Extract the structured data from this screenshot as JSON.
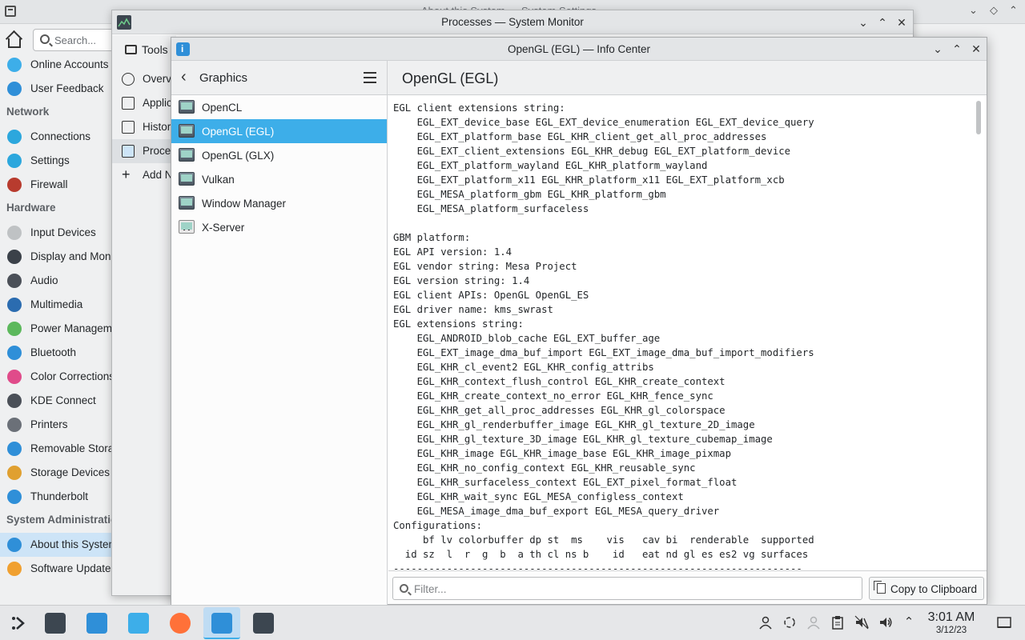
{
  "settings": {
    "window_title": "About this System — System Settings",
    "search_placeholder": "Search...",
    "items_top": [
      {
        "label": "Online Accounts",
        "color": "#3daee9"
      },
      {
        "label": "User Feedback",
        "color": "#2f8fd8"
      }
    ],
    "sections": [
      {
        "title": "Network",
        "items": [
          {
            "label": "Connections",
            "color": "#2ca7dd"
          },
          {
            "label": "Settings",
            "color": "#2ca7dd"
          },
          {
            "label": "Firewall",
            "color": "#b83b2e"
          }
        ]
      },
      {
        "title": "Hardware",
        "items": [
          {
            "label": "Input Devices",
            "color": "#bfc2c4"
          },
          {
            "label": "Display and Monitor",
            "color": "#3b4149"
          },
          {
            "label": "Audio",
            "color": "#4b5058"
          },
          {
            "label": "Multimedia",
            "color": "#2b6cb0"
          },
          {
            "label": "Power Management",
            "color": "#5cb85c"
          },
          {
            "label": "Bluetooth",
            "color": "#2f8fd8"
          },
          {
            "label": "Color Corrections",
            "color": "#e04b8a"
          },
          {
            "label": "KDE Connect",
            "color": "#4b5058"
          },
          {
            "label": "Printers",
            "color": "#6b7078"
          },
          {
            "label": "Removable Storage",
            "color": "#2f8fd8"
          },
          {
            "label": "Storage Devices",
            "color": "#e0a030"
          },
          {
            "label": "Thunderbolt",
            "color": "#2f8fd8"
          }
        ]
      },
      {
        "title": "System Administration",
        "items": [
          {
            "label": "About this System",
            "color": "#2f8fd8",
            "selected": true
          },
          {
            "label": "Software Update",
            "color": "#f0a030"
          }
        ]
      }
    ]
  },
  "sysmon": {
    "title": "Processes — System Monitor",
    "tools_label": "Tools",
    "items": [
      {
        "label": "Overview",
        "icon": "overview-icon"
      },
      {
        "label": "Applications",
        "icon": "applications-icon"
      },
      {
        "label": "History",
        "icon": "history-icon"
      },
      {
        "label": "Processes",
        "icon": "processes-icon",
        "selected": true
      },
      {
        "label": "Add New Page",
        "icon": "add-icon"
      }
    ]
  },
  "info": {
    "title": "OpenGL (EGL) — Info Center",
    "category": "Graphics",
    "page_title": "OpenGL (EGL)",
    "items": [
      {
        "label": "OpenCL"
      },
      {
        "label": "OpenGL (EGL)",
        "selected": true
      },
      {
        "label": "OpenGL (GLX)"
      },
      {
        "label": "Vulkan"
      },
      {
        "label": "Window Manager"
      },
      {
        "label": "X-Server"
      }
    ],
    "content": "EGL client extensions string:\n    EGL_EXT_device_base EGL_EXT_device_enumeration EGL_EXT_device_query\n    EGL_EXT_platform_base EGL_KHR_client_get_all_proc_addresses\n    EGL_EXT_client_extensions EGL_KHR_debug EGL_EXT_platform_device\n    EGL_EXT_platform_wayland EGL_KHR_platform_wayland\n    EGL_EXT_platform_x11 EGL_KHR_platform_x11 EGL_EXT_platform_xcb\n    EGL_MESA_platform_gbm EGL_KHR_platform_gbm\n    EGL_MESA_platform_surfaceless\n\nGBM platform:\nEGL API version: 1.4\nEGL vendor string: Mesa Project\nEGL version string: 1.4\nEGL client APIs: OpenGL OpenGL_ES\nEGL driver name: kms_swrast\nEGL extensions string:\n    EGL_ANDROID_blob_cache EGL_EXT_buffer_age\n    EGL_EXT_image_dma_buf_import EGL_EXT_image_dma_buf_import_modifiers\n    EGL_KHR_cl_event2 EGL_KHR_config_attribs\n    EGL_KHR_context_flush_control EGL_KHR_create_context\n    EGL_KHR_create_context_no_error EGL_KHR_fence_sync\n    EGL_KHR_get_all_proc_addresses EGL_KHR_gl_colorspace\n    EGL_KHR_gl_renderbuffer_image EGL_KHR_gl_texture_2D_image\n    EGL_KHR_gl_texture_3D_image EGL_KHR_gl_texture_cubemap_image\n    EGL_KHR_image EGL_KHR_image_base EGL_KHR_image_pixmap\n    EGL_KHR_no_config_context EGL_KHR_reusable_sync\n    EGL_KHR_surfaceless_context EGL_EXT_pixel_format_float\n    EGL_KHR_wait_sync EGL_MESA_configless_context\n    EGL_MESA_image_dma_buf_export EGL_MESA_query_driver\nConfigurations:\n     bf lv colorbuffer dp st  ms    vis   cav bi  renderable  supported\n  id sz  l  r  g  b  a th cl ns b    id   eat nd gl es es2 vg surfaces\n---------------------------------------------------------------------",
    "filter_placeholder": "Filter...",
    "copy_label": "Copy to Clipboard"
  },
  "taskbar": {
    "time": "3:01 AM",
    "date": "3/12/23",
    "apps": [
      {
        "name": "app-launcher",
        "color": "#2a2e32"
      },
      {
        "name": "system-settings",
        "color": "#3c4650"
      },
      {
        "name": "discover",
        "color": "#2f8fd8"
      },
      {
        "name": "dolphin",
        "color": "#3daee9"
      },
      {
        "name": "firefox",
        "color": "#ff7139"
      },
      {
        "name": "info-center",
        "color": "#2f8fd8",
        "active": true
      },
      {
        "name": "system-monitor",
        "color": "#3c4650"
      }
    ]
  }
}
